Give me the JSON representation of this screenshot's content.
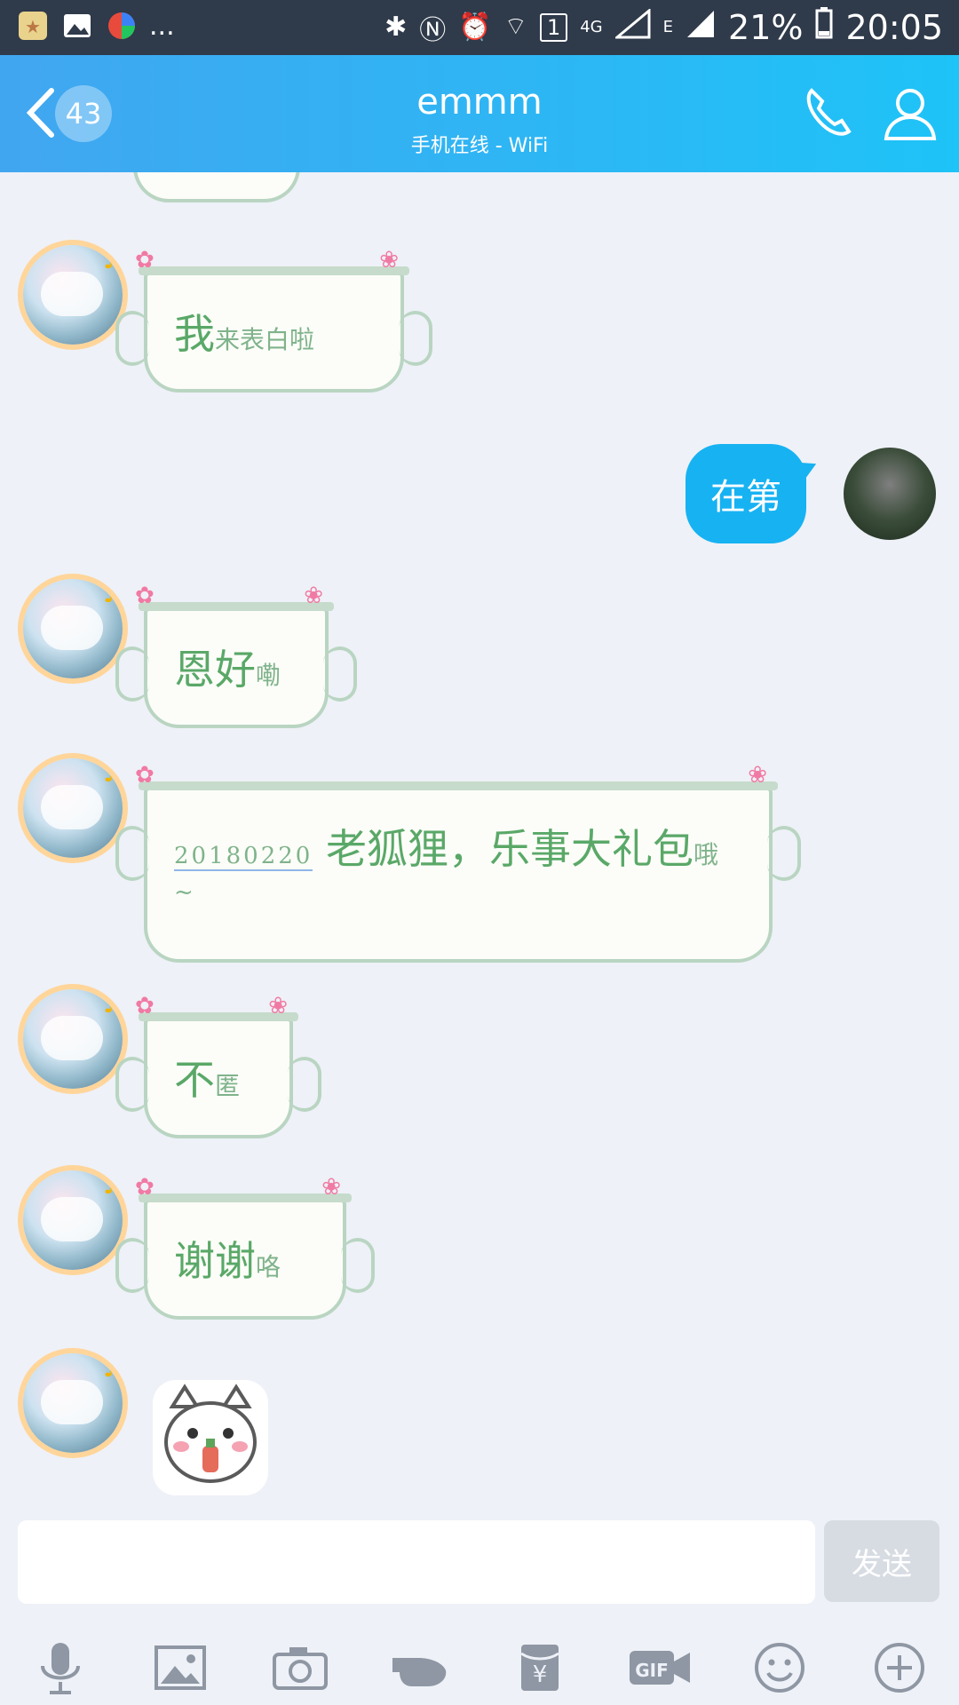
{
  "status_bar": {
    "dots": "...",
    "network": "4G",
    "signal_letter": "E",
    "sim": "1",
    "battery": "21%",
    "time": "20:05"
  },
  "header": {
    "unread_count": "43",
    "title": "emmm",
    "subtitle": "手机在线 - WiFi"
  },
  "messages": {
    "m1": {
      "big": "我",
      "small": "来表白啦"
    },
    "m2": {
      "text": "在第"
    },
    "m3": {
      "big": "恩好",
      "small": "嘞"
    },
    "m4": {
      "date": "20180220",
      "big": "老狐狸，乐事大礼包",
      "small": "哦",
      "tail": "~"
    },
    "m5": {
      "big": "不",
      "small": "匿"
    },
    "m6": {
      "big": "谢谢",
      "small": "咯"
    }
  },
  "input": {
    "placeholder": "",
    "send_label": "发送"
  },
  "toolbar": {
    "icons": [
      "microphone-icon",
      "image-icon",
      "camera-icon",
      "poke-icon",
      "red-packet-icon",
      "gif-icon",
      "emoji-icon",
      "plus-icon"
    ]
  }
}
